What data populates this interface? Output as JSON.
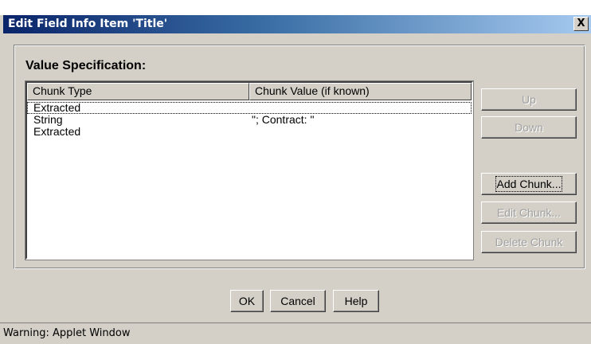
{
  "window": {
    "title": "Edit Field Info Item 'Title'",
    "close_glyph": "X"
  },
  "group": {
    "label": "Value Specification:"
  },
  "table": {
    "columns": [
      "Chunk Type",
      "Chunk Value (if known)"
    ],
    "rows": [
      {
        "type": "Extracted",
        "value": ""
      },
      {
        "type": "String",
        "value": "\"; Contract: \""
      },
      {
        "type": "Extracted",
        "value": ""
      }
    ]
  },
  "side_buttons": {
    "up": "Up",
    "down": "Down",
    "add_chunk": "Add Chunk...",
    "edit_chunk": "Edit Chunk...",
    "delete_chunk": "Delete Chunk"
  },
  "bottom_buttons": {
    "ok": "OK",
    "cancel": "Cancel",
    "help": "Help"
  },
  "status": {
    "text": "Warning: Applet Window"
  },
  "colors": {
    "face": "#d4d0c8",
    "title_start": "#0a246a",
    "title_end": "#a6caf0"
  }
}
